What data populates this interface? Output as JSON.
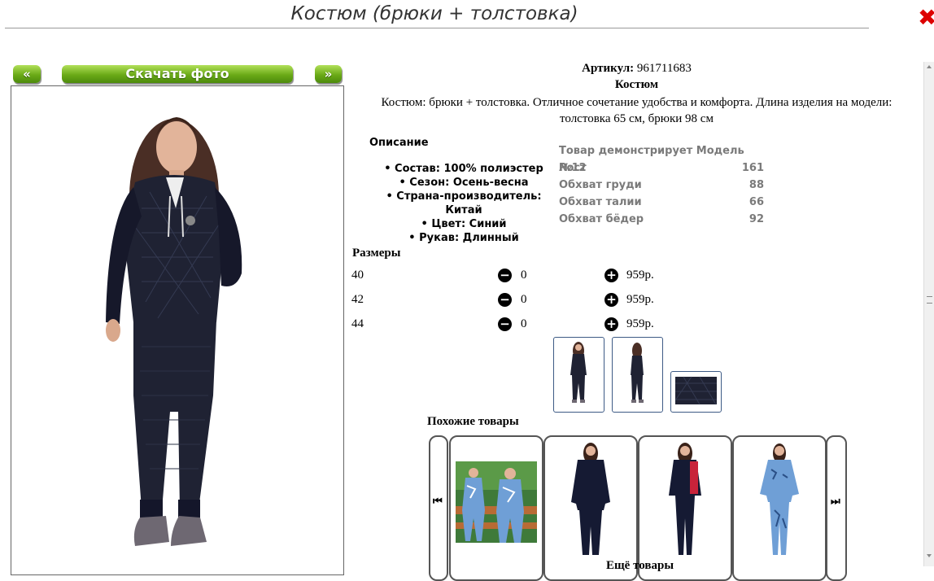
{
  "window": {
    "title": "Костюм (брюки + толстовка)",
    "close_glyph": "✖"
  },
  "gallery": {
    "prev_label": "«",
    "download_label": "Скачать фото",
    "next_label": "»"
  },
  "product": {
    "article_label": "Артикул:",
    "article_value": "961711683",
    "type": "Костюм",
    "description": "Костюм: брюки + толстовка. Отличное сочетание удобства и комфорта. Длина изделия на модели: толстовка 65 см, брюки 98 см",
    "description_heading": "Описание",
    "attributes": [
      "Состав: 100% полиэстер",
      "Сезон: Осень-весна",
      "Страна-производитель: Китай",
      "Цвет: Синий",
      "Рукав: Длинный"
    ]
  },
  "model": {
    "heading": "Товар демонстрирует Модель №12",
    "rows": [
      {
        "label": "Рост",
        "value": "161"
      },
      {
        "label": "Обхват груди",
        "value": "88"
      },
      {
        "label": "Обхват талии",
        "value": "66"
      },
      {
        "label": "Обхват бёдер",
        "value": "92"
      }
    ]
  },
  "sizes": {
    "heading": "Размеры",
    "rows": [
      {
        "size": "40",
        "qty": "0",
        "price": "959р."
      },
      {
        "size": "42",
        "qty": "0",
        "price": "959р."
      },
      {
        "size": "44",
        "qty": "0",
        "price": "959р."
      }
    ],
    "minus_glyph": "−",
    "plus_glyph": "+"
  },
  "similar": {
    "heading": "Похожие товары",
    "prev_glyph": "⏮",
    "next_glyph": "⏭"
  },
  "more": {
    "heading": "Ещё товары"
  },
  "colors": {
    "button_green": "#6aaa17",
    "close_red": "#dd0000",
    "suit_navy": "#1f2233",
    "camo_blue": "#6f9fd6",
    "accent_red": "#c8233a",
    "muted_text": "#7a7a7a"
  }
}
